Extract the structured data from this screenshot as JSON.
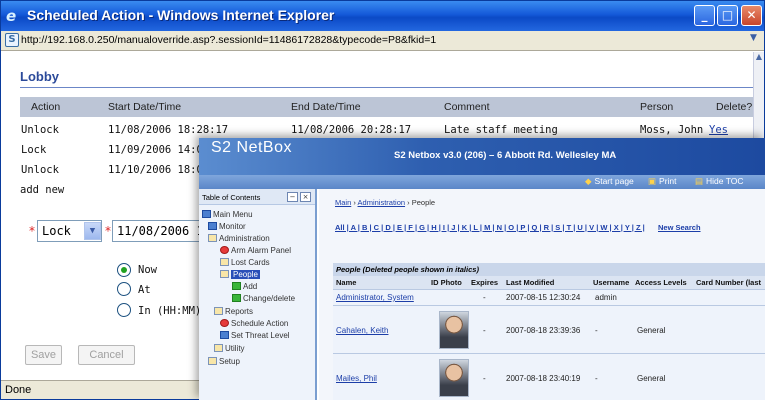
{
  "ie": {
    "title": "Scheduled Action - Windows Internet Explorer",
    "url": "http://192.168.0.250/manualoverride.asp?.sessionId=11486172828&typecode=P8&fkid=1",
    "status": "Done",
    "icons": {
      "app": "ie-logo-icon",
      "page": "page-icon",
      "minimize": "minimize-icon",
      "maximize": "maximize-icon",
      "close": "close-icon"
    }
  },
  "lobby": {
    "title": "Lobby",
    "columns": [
      "Action",
      "Start Date/Time",
      "End Date/Time",
      "Comment",
      "Person",
      "Delete?"
    ],
    "rows": [
      {
        "action": "Unlock",
        "start": "11/08/2006 18:28:17",
        "end": "11/08/2006 20:28:17",
        "comment": "Late staff meeting",
        "person": "Moss, John",
        "delete": "Yes"
      },
      {
        "action": "Lock",
        "start": "11/09/2006 14:00",
        "end": "",
        "comment": "",
        "person": "",
        "delete": ""
      },
      {
        "action": "Unlock",
        "start": "11/10/2006 18:00",
        "end": "",
        "comment": "",
        "person": "",
        "delete": ""
      }
    ],
    "add_new": "add new"
  },
  "form": {
    "required_mark": "*",
    "action_value": "Lock",
    "date_value": "11/08/2006 17",
    "radio_now": "Now",
    "radio_at": "At",
    "radio_in": "In (HH:MM)",
    "save": "Save",
    "cancel": "Cancel"
  },
  "netbox": {
    "logo": "S2 NetBox",
    "version": "S2 Netbox v3.0 (206) – 6 Abbott Rd. Wellesley MA",
    "toolbar": [
      "Start page",
      "Print",
      "Hide TOC"
    ],
    "toc": {
      "title": "Table of Contents",
      "items": [
        "Main Menu",
        "Monitor",
        "Administration",
        "Arm Alarm Panel",
        "Lost Cards",
        "People",
        "Add",
        "Change/delete",
        "Reports",
        "Schedule Action",
        "Set Threat Level",
        "Utility",
        "Setup"
      ]
    },
    "breadcrumb": {
      "main": "Main",
      "admin": "Administration",
      "current": "People",
      "sep": "›"
    },
    "alpha": "All | A | B | C | D | E | F | G | H | I | J | K | L | M | N | O | P | Q | R | S | T | U | V | W | X | Y | Z |",
    "new_search": "New Search",
    "people": {
      "caption": "People (Deleted people shown in italics)",
      "columns": [
        "Name",
        "ID Photo",
        "Expires",
        "Last Modified",
        "Username",
        "Access Levels",
        "Card Number (last"
      ],
      "rows": [
        {
          "name": "Administrator, System",
          "expires": "-",
          "modified": "2007-08-15 12:30:24",
          "username": "admin",
          "access": ""
        },
        {
          "name": "Cahalen, Keith",
          "expires": "-",
          "modified": "2007-08-18 23:39:36",
          "username": "-",
          "access": "General"
        },
        {
          "name": "Mailes, Phil",
          "expires": "-",
          "modified": "2007-08-18 23:40:19",
          "username": "-",
          "access": "General"
        }
      ]
    }
  }
}
